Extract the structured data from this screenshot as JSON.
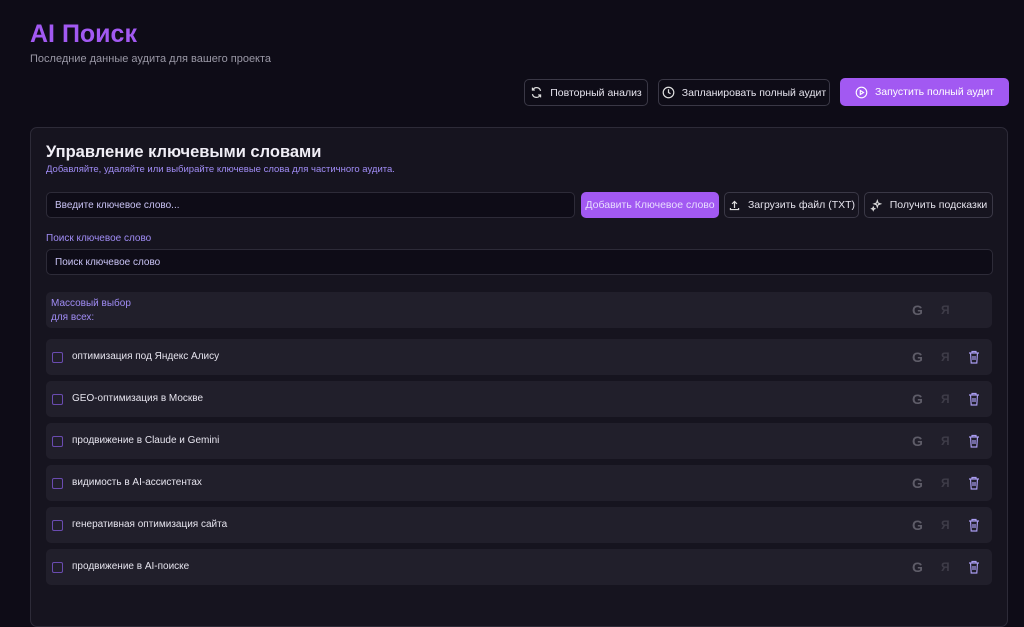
{
  "header": {
    "title": "AI Поиск",
    "subtitle": "Последние данные аудита для вашего проекта"
  },
  "actions": {
    "reanalyze": "Повторный анализ",
    "schedule": "Запланировать полный аудит",
    "run": "Запустить полный аудит"
  },
  "card": {
    "title": "Управление ключевыми словами",
    "subtitle": "Добавляйте, удаляйте или выбирайте ключевые слова для частичного аудита.",
    "keyword_placeholder": "Введите ключевое слово...",
    "add_button": "Добавить Ключевое слово",
    "upload_button": "Загрузить файл (TXT)",
    "hints_button": "Получить подсказки",
    "search_label": "Поиск ключевое слово",
    "search_placeholder": "Поиск ключевое слово",
    "mass_select": "Массовый выбор\nдля всех:",
    "keywords": [
      "оптимизация под Яндекс Алису",
      "GEO-оптимизация в Москве",
      "продвижение в Claude и Gemini",
      "видимость в AI-ассистентах",
      "генеративная оптимизация сайта",
      "продвижение в AI-поиске"
    ]
  },
  "icons": {
    "google": "G",
    "yandex": "Я"
  },
  "colors": {
    "accent": "#a259f2",
    "background": "#0e0c17"
  }
}
